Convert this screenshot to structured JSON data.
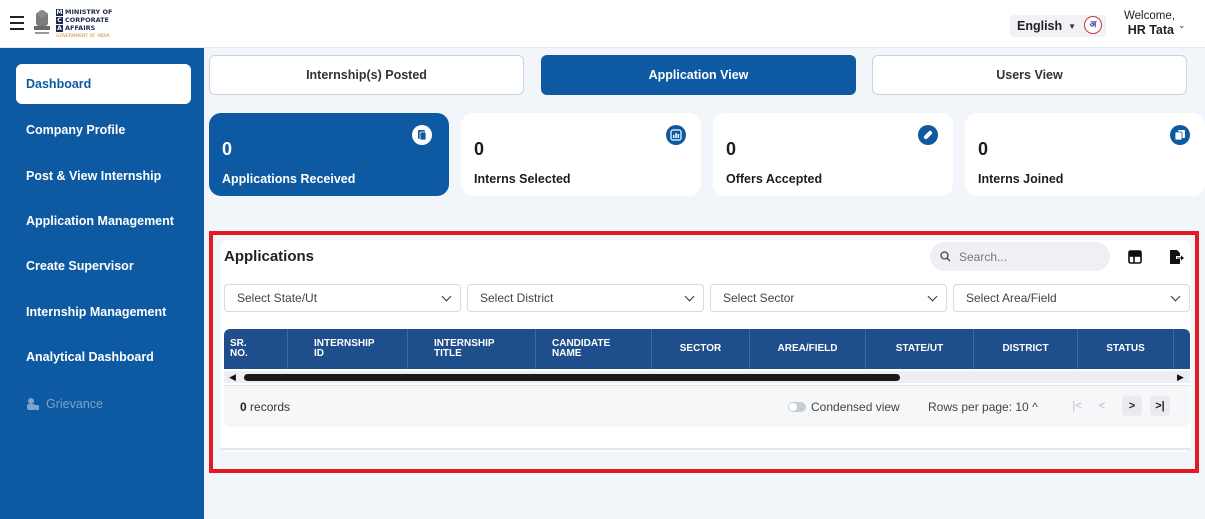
{
  "header": {
    "logo_lines": [
      "M",
      "MINISTRY OF",
      "C",
      "CORPORATE",
      "A",
      "AFFAIRS"
    ],
    "logo_sub": "GOVERNMENT OF INDIA",
    "language": "English",
    "hindi_glyph": "अ",
    "welcome": "Welcome,",
    "user": "HR Tata"
  },
  "sidebar": {
    "items": [
      {
        "label": "Dashboard"
      },
      {
        "label": "Company Profile"
      },
      {
        "label": "Post & View Internship"
      },
      {
        "label": "Application Management"
      },
      {
        "label": "Create Supervisor"
      },
      {
        "label": "Internship Management"
      },
      {
        "label": "Analytical Dashboard"
      },
      {
        "label": "Grievance"
      }
    ]
  },
  "tabs": [
    {
      "label": "Internship(s) Posted"
    },
    {
      "label": "Application View"
    },
    {
      "label": "Users View"
    }
  ],
  "cards": [
    {
      "value": "0",
      "label": "Applications Received"
    },
    {
      "value": "0",
      "label": "Interns Selected"
    },
    {
      "value": "0",
      "label": "Offers Accepted"
    },
    {
      "value": "0",
      "label": "Interns Joined"
    }
  ],
  "applications": {
    "title": "Applications",
    "search_placeholder": "Search...",
    "filters": [
      "Select State/Ut",
      "Select District",
      "Select Sector",
      "Select Area/Field"
    ],
    "columns": [
      {
        "l1": "SR.",
        "l2": "NO."
      },
      {
        "l1": "INTERNSHIP",
        "l2": "ID"
      },
      {
        "l1": "INTERNSHIP",
        "l2": "TITLE"
      },
      {
        "l1": "CANDIDATE",
        "l2": "NAME"
      },
      {
        "l1": "SECTOR",
        "l2": ""
      },
      {
        "l1": "AREA/FIELD",
        "l2": ""
      },
      {
        "l1": "STATE/UT",
        "l2": ""
      },
      {
        "l1": "DISTRICT",
        "l2": ""
      },
      {
        "l1": "STATUS",
        "l2": ""
      }
    ],
    "record_count": "0",
    "records_label": "records",
    "condensed_label": "Condensed view",
    "rows_per_page": "Rows per page: 10",
    "rows_per_page_caret": "^",
    "pager": {
      "first": "|<",
      "prev": "<",
      "next": ">",
      "last": ">|"
    }
  },
  "colors": {
    "primary": "#0e5aa2",
    "table_header": "#1f4e8c",
    "highlight": "#e11b22"
  }
}
